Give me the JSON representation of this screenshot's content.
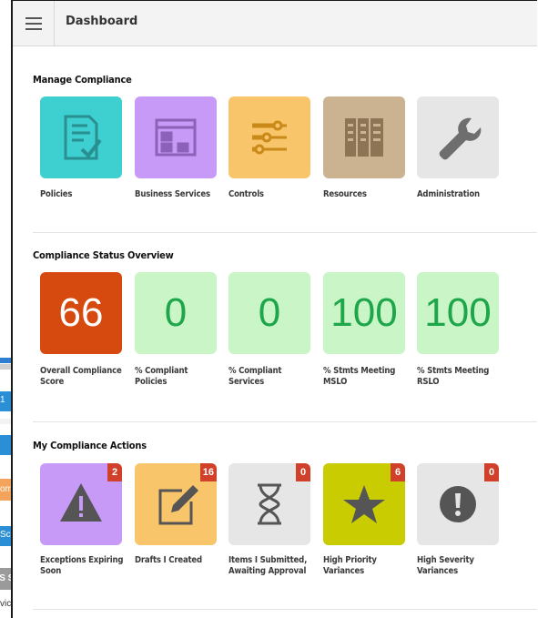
{
  "header": {
    "title": "Dashboard"
  },
  "manage": {
    "title": "Manage Compliance",
    "tiles": [
      {
        "label": "Policies",
        "color": "#3ecfd0",
        "icon": "policy-document-icon"
      },
      {
        "label": "Business Services",
        "color": "#c89af7",
        "icon": "browser-window-icon"
      },
      {
        "label": "Controls",
        "color": "#f9c56a",
        "icon": "sliders-icon"
      },
      {
        "label": "Resources",
        "color": "#cbb392",
        "icon": "server-racks-icon"
      },
      {
        "label": "Administration",
        "color": "#e6e6e6",
        "icon": "wrench-icon"
      }
    ]
  },
  "status": {
    "title": "Compliance Status Overview",
    "tiles": [
      {
        "value": "66",
        "label": "Overall Compliance Score",
        "color": "#d64a0f",
        "text_color": "#ffffff"
      },
      {
        "value": "0",
        "label": "% Compliant Policies",
        "color": "#c9f5c7",
        "text_color": "#1ea64a"
      },
      {
        "value": "0",
        "label": "% Compliant Services",
        "color": "#c9f5c7",
        "text_color": "#1ea64a"
      },
      {
        "value": "100",
        "label": "% Stmts Meeting MSLO",
        "color": "#c9f5c7",
        "text_color": "#1ea64a"
      },
      {
        "value": "100",
        "label": "% Stmts Meeting RSLO",
        "color": "#c9f5c7",
        "text_color": "#1ea64a"
      }
    ]
  },
  "actions": {
    "title": "My Compliance Actions",
    "tiles": [
      {
        "count": "2",
        "label": "Exceptions Expiring Soon",
        "color": "#c89af7",
        "icon": "warning-triangle-icon"
      },
      {
        "count": "16",
        "label": "Drafts I Created",
        "color": "#f9c56a",
        "icon": "edit-pencil-icon"
      },
      {
        "count": "0",
        "label": "Items I Submitted, Awaiting Approval",
        "color": "#e6e6e6",
        "icon": "hourglass-icon"
      },
      {
        "count": "6",
        "label": "High Priority Variances",
        "color": "#c8cc00",
        "icon": "star-icon"
      },
      {
        "count": "0",
        "label": "High Severity Variances",
        "color": "#e6e6e6",
        "icon": "exclamation-circle-icon"
      }
    ]
  },
  "background_window": {
    "fragments": [
      "1",
      "om",
      "Sc",
      "S SE",
      "vice"
    ]
  }
}
